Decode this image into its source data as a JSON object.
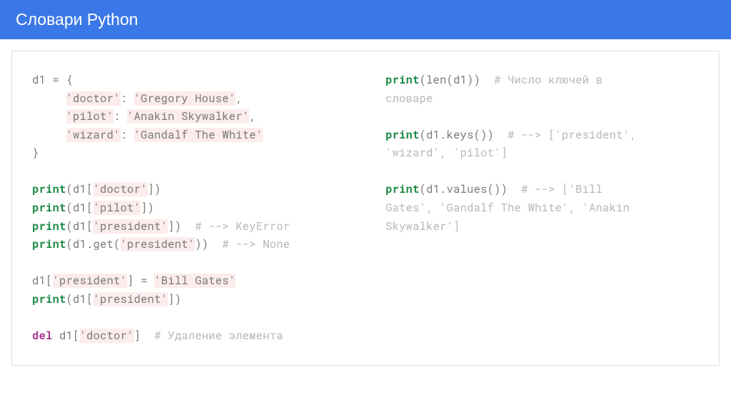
{
  "header": {
    "title": "Словари Python"
  },
  "code": {
    "left": {
      "l1_a": "d1 ",
      "l1_b": "=",
      "l1_c": " {",
      "l2_a": "     ",
      "l2_b": "'doctor'",
      "l2_c": ": ",
      "l2_d": "'Gregory House'",
      "l2_e": ",",
      "l3_a": "     ",
      "l3_b": "'pilot'",
      "l3_c": ": ",
      "l3_d": "'Anakin Skywalker'",
      "l3_e": ",",
      "l4_a": "     ",
      "l4_b": "'wizard'",
      "l4_c": ": ",
      "l4_d": "'Gandalf The White'",
      "l5": "}",
      "l7_a": "print",
      "l7_b": "(d1[",
      "l7_c": "'doctor'",
      "l7_d": "])",
      "l8_a": "print",
      "l8_b": "(d1[",
      "l8_c": "'pilot'",
      "l8_d": "])",
      "l9_a": "print",
      "l9_b": "(d1[",
      "l9_c": "'president'",
      "l9_d": "])  ",
      "l9_e": "# --> KeyError",
      "l10_a": "print",
      "l10_b": "(d1.get(",
      "l10_c": "'president'",
      "l10_d": "))  ",
      "l10_e": "# --> None",
      "l12_a": "d1[",
      "l12_b": "'president'",
      "l12_c": "] ",
      "l12_d": "=",
      "l12_e": " ",
      "l12_f": "'Bill Gates'",
      "l13_a": "print",
      "l13_b": "(d1[",
      "l13_c": "'president'",
      "l13_d": "])",
      "l15_a": "del",
      "l15_b": " d1[",
      "l15_c": "'doctor'",
      "l15_d": "]  ",
      "l15_e": "# Удаление элемента"
    },
    "right": {
      "r1_a": "print",
      "r1_b": "(len(d1))  ",
      "r1_c": "# Число ключей в",
      "r2": "словаре",
      "r4_a": "print",
      "r4_b": "(d1.keys())  ",
      "r4_c": "# --> ['president',",
      "r5": "'wizard', 'pilot']",
      "r7_a": "print",
      "r7_b": "(d1.values())  ",
      "r7_c": "# --> ['Bill",
      "r8": "Gates', 'Gandalf The White', 'Anakin",
      "r9": "Skywalker']"
    }
  }
}
